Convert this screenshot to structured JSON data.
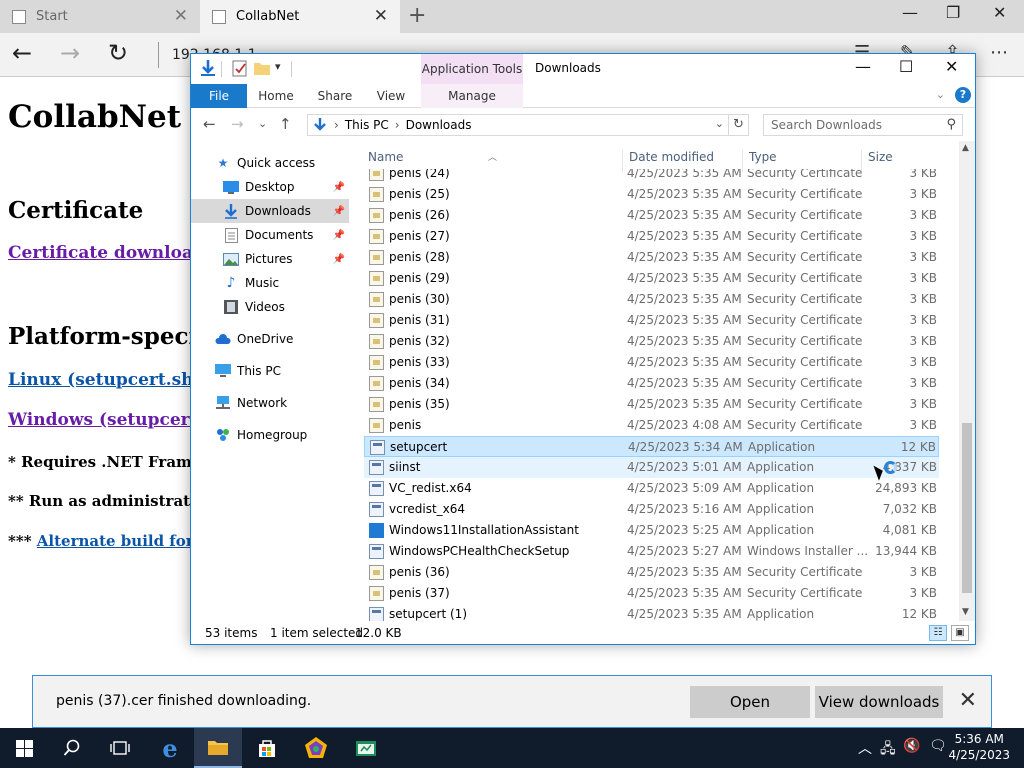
{
  "browser": {
    "tabs": [
      {
        "title": "Start"
      },
      {
        "title": "CollabNet"
      }
    ],
    "tab_close": "✕",
    "new_tab": "+",
    "address": "192.168.1.1",
    "window_buttons": {
      "minimize": "—",
      "maximize": "❐",
      "close": "✕"
    },
    "icons": {
      "back": "←",
      "forward": "→",
      "refresh": "↻",
      "more": "⋯"
    }
  },
  "webpage": {
    "heading": "CollabNet Do",
    "section_certificate": "Certificate",
    "cert_link": "Certificate download (c",
    "section_platform": "Platform-specific",
    "linux_link": "Linux (setupcert.sh)",
    "windows_link": "Windows (setupcert.ex",
    "note1": "* Requires .NET Framewo",
    "note2": "** Run as administrator to",
    "note3_prefix": "*** ",
    "note3_link": "Alternate build for Vis"
  },
  "download_bar": {
    "message": "penis (37).cer finished downloading.",
    "open_label": "Open",
    "view_label": "View downloads",
    "close": "✕"
  },
  "explorer": {
    "title": "Downloads",
    "context_tab": "Application Tools",
    "ribbon_tabs": [
      "File",
      "Home",
      "Share",
      "View",
      "Manage"
    ],
    "help": "?",
    "address": {
      "root": "This PC",
      "sep": "›",
      "current": "Downloads"
    },
    "search_placeholder": "Search Downloads",
    "nav_items": [
      {
        "label": "Quick access",
        "icon": "star-icon"
      },
      {
        "label": "Desktop",
        "icon": "desktop-icon",
        "pinned": true
      },
      {
        "label": "Downloads",
        "icon": "download-icon",
        "pinned": true,
        "selected": true
      },
      {
        "label": "Documents",
        "icon": "documents-icon",
        "pinned": true
      },
      {
        "label": "Pictures",
        "icon": "pictures-icon",
        "pinned": true
      },
      {
        "label": "Music",
        "icon": "music-icon"
      },
      {
        "label": "Videos",
        "icon": "videos-icon"
      },
      {
        "label": "OneDrive",
        "icon": "cloud-icon"
      },
      {
        "label": "This PC",
        "icon": "computer-icon"
      },
      {
        "label": "Network",
        "icon": "network-icon"
      },
      {
        "label": "Homegroup",
        "icon": "homegroup-icon"
      }
    ],
    "columns": {
      "name": "Name",
      "date": "Date modified",
      "type": "Type",
      "size": "Size"
    },
    "files": [
      {
        "name": "penis (24)",
        "date": "4/25/2023 5:35 AM",
        "type": "Security Certificate",
        "size": "3 KB",
        "kind": "cert"
      },
      {
        "name": "penis (25)",
        "date": "4/25/2023 5:35 AM",
        "type": "Security Certificate",
        "size": "3 KB",
        "kind": "cert"
      },
      {
        "name": "penis (26)",
        "date": "4/25/2023 5:35 AM",
        "type": "Security Certificate",
        "size": "3 KB",
        "kind": "cert"
      },
      {
        "name": "penis (27)",
        "date": "4/25/2023 5:35 AM",
        "type": "Security Certificate",
        "size": "3 KB",
        "kind": "cert"
      },
      {
        "name": "penis (28)",
        "date": "4/25/2023 5:35 AM",
        "type": "Security Certificate",
        "size": "3 KB",
        "kind": "cert"
      },
      {
        "name": "penis (29)",
        "date": "4/25/2023 5:35 AM",
        "type": "Security Certificate",
        "size": "3 KB",
        "kind": "cert"
      },
      {
        "name": "penis (30)",
        "date": "4/25/2023 5:35 AM",
        "type": "Security Certificate",
        "size": "3 KB",
        "kind": "cert"
      },
      {
        "name": "penis (31)",
        "date": "4/25/2023 5:35 AM",
        "type": "Security Certificate",
        "size": "3 KB",
        "kind": "cert"
      },
      {
        "name": "penis (32)",
        "date": "4/25/2023 5:35 AM",
        "type": "Security Certificate",
        "size": "3 KB",
        "kind": "cert"
      },
      {
        "name": "penis (33)",
        "date": "4/25/2023 5:35 AM",
        "type": "Security Certificate",
        "size": "3 KB",
        "kind": "cert"
      },
      {
        "name": "penis (34)",
        "date": "4/25/2023 5:35 AM",
        "type": "Security Certificate",
        "size": "3 KB",
        "kind": "cert"
      },
      {
        "name": "penis (35)",
        "date": "4/25/2023 5:35 AM",
        "type": "Security Certificate",
        "size": "3 KB",
        "kind": "cert"
      },
      {
        "name": "penis",
        "date": "4/25/2023 4:08 AM",
        "type": "Security Certificate",
        "size": "3 KB",
        "kind": "cert"
      },
      {
        "name": "setupcert",
        "date": "4/25/2023 5:34 AM",
        "type": "Application",
        "size": "12 KB",
        "kind": "app",
        "selected": true
      },
      {
        "name": "siinst",
        "date": "4/25/2023 5:01 AM",
        "type": "Application",
        "size": "4,837 KB",
        "kind": "app",
        "hover": true
      },
      {
        "name": "VC_redist.x64",
        "date": "4/25/2023 5:09 AM",
        "type": "Application",
        "size": "24,893 KB",
        "kind": "app"
      },
      {
        "name": "vcredist_x64",
        "date": "4/25/2023 5:16 AM",
        "type": "Application",
        "size": "7,032 KB",
        "kind": "app"
      },
      {
        "name": "Windows11InstallationAssistant",
        "date": "4/25/2023 5:25 AM",
        "type": "Application",
        "size": "4,081 KB",
        "kind": "win"
      },
      {
        "name": "WindowsPCHealthCheckSetup",
        "date": "4/25/2023 5:27 AM",
        "type": "Windows Installer ...",
        "size": "13,944 KB",
        "kind": "app"
      },
      {
        "name": "penis (36)",
        "date": "4/25/2023 5:35 AM",
        "type": "Security Certificate",
        "size": "3 KB",
        "kind": "cert"
      },
      {
        "name": "penis (37)",
        "date": "4/25/2023 5:35 AM",
        "type": "Security Certificate",
        "size": "3 KB",
        "kind": "cert"
      },
      {
        "name": "setupcert (1)",
        "date": "4/25/2023 5:35 AM",
        "type": "Application",
        "size": "12 KB",
        "kind": "app"
      }
    ],
    "status": {
      "items": "53 items",
      "selected": "1 item selected",
      "size": "12.0 KB"
    }
  },
  "taskbar": {
    "time": "5:36 AM",
    "date": "4/25/2023"
  }
}
